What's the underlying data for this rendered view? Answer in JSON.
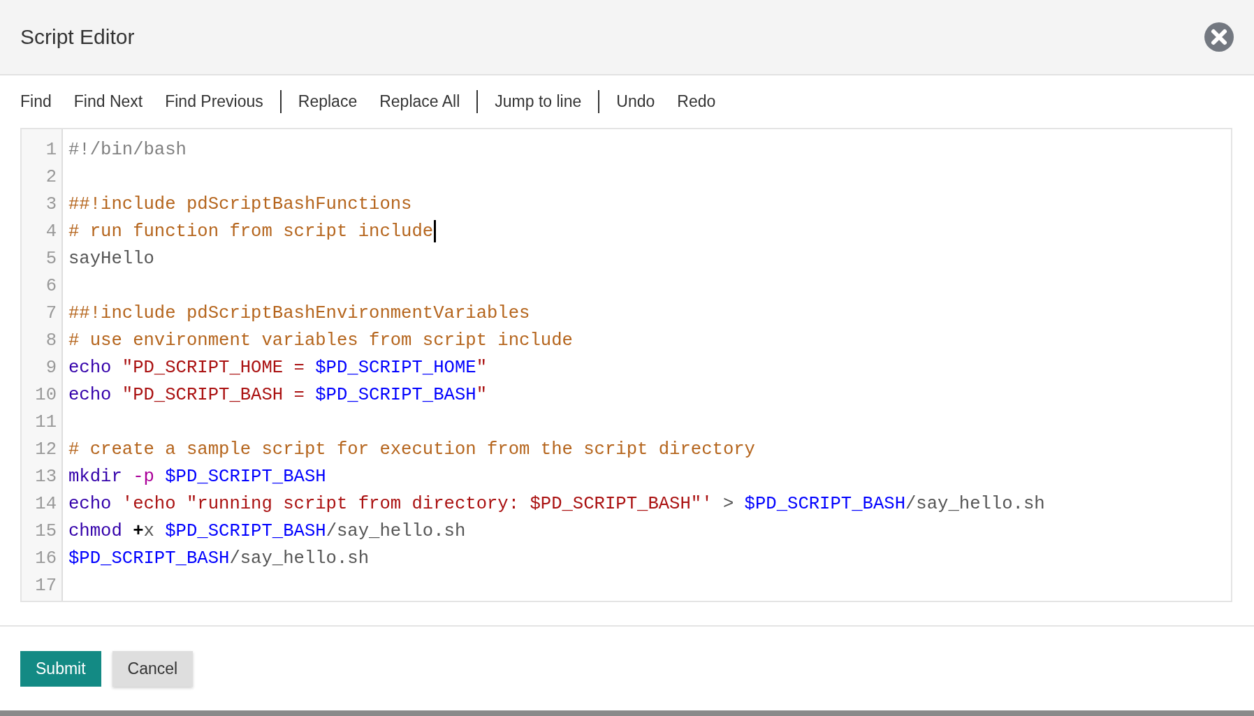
{
  "dialog": {
    "title": "Script Editor"
  },
  "toolbar": [
    [
      "Find",
      "Find Next",
      "Find Previous"
    ],
    [
      "Replace",
      "Replace All"
    ],
    [
      "Jump to line"
    ],
    [
      "Undo",
      "Redo"
    ]
  ],
  "editor": {
    "lines": [
      {
        "number": "1",
        "cursor": false,
        "tokens": [
          {
            "kind": "meta",
            "text": "#!/bin/bash"
          }
        ]
      },
      {
        "number": "2",
        "cursor": false
      },
      {
        "number": "3",
        "cursor": false,
        "tokens": [
          {
            "kind": "comment",
            "text": "##!include pdScriptBashFunctions"
          }
        ]
      },
      {
        "number": "4",
        "cursor": true,
        "tokens": [
          {
            "kind": "comment",
            "text": "# run function from script include"
          }
        ]
      },
      {
        "number": "5",
        "cursor": false,
        "tokens": [
          {
            "kind": "plain",
            "text": "sayHello"
          }
        ]
      },
      {
        "number": "6",
        "cursor": false
      },
      {
        "number": "7",
        "cursor": false,
        "tokens": [
          {
            "kind": "comment",
            "text": "##!include pdScriptBashEnvironmentVariables"
          }
        ]
      },
      {
        "number": "8",
        "cursor": false,
        "tokens": [
          {
            "kind": "comment",
            "text": "# use environment variables from script include"
          }
        ]
      },
      {
        "number": "9",
        "cursor": false,
        "tokens": [
          {
            "kind": "builtin",
            "text": "echo "
          },
          {
            "kind": "string",
            "text": "\"PD_SCRIPT_HOME = "
          },
          {
            "kind": "variable",
            "text": "$PD_SCRIPT_HOME"
          },
          {
            "kind": "string",
            "text": "\""
          }
        ]
      },
      {
        "number": "10",
        "cursor": false,
        "tokens": [
          {
            "kind": "builtin",
            "text": "echo "
          },
          {
            "kind": "string",
            "text": "\"PD_SCRIPT_BASH = "
          },
          {
            "kind": "variable",
            "text": "$PD_SCRIPT_BASH"
          },
          {
            "kind": "string",
            "text": "\""
          }
        ]
      },
      {
        "number": "11",
        "cursor": false
      },
      {
        "number": "12",
        "cursor": false,
        "tokens": [
          {
            "kind": "comment",
            "text": "# create a sample script for execution from the script directory"
          }
        ]
      },
      {
        "number": "13",
        "cursor": false,
        "tokens": [
          {
            "kind": "builtin",
            "text": "mkdir "
          },
          {
            "kind": "option",
            "text": "-p "
          },
          {
            "kind": "variable",
            "text": "$PD_SCRIPT_BASH"
          }
        ]
      },
      {
        "number": "14",
        "cursor": false,
        "tokens": [
          {
            "kind": "builtin",
            "text": "echo "
          },
          {
            "kind": "string",
            "text": "'echo \"running script from directory: $PD_SCRIPT_BASH\"'"
          },
          {
            "kind": "plain",
            "text": " > "
          },
          {
            "kind": "variable",
            "text": "$PD_SCRIPT_BASH"
          },
          {
            "kind": "plain",
            "text": "/say_hello.sh"
          }
        ]
      },
      {
        "number": "15",
        "cursor": false,
        "tokens": [
          {
            "kind": "builtin",
            "text": "chmod "
          },
          {
            "kind": "operator",
            "text": "+"
          },
          {
            "kind": "plain",
            "text": "x "
          },
          {
            "kind": "variable",
            "text": "$PD_SCRIPT_BASH"
          },
          {
            "kind": "plain",
            "text": "/say_hello.sh"
          }
        ]
      },
      {
        "number": "16",
        "cursor": false,
        "tokens": [
          {
            "kind": "variable",
            "text": "$PD_SCRIPT_BASH"
          },
          {
            "kind": "plain",
            "text": "/say_hello.sh"
          }
        ]
      },
      {
        "number": "17",
        "cursor": false
      }
    ]
  },
  "footer": {
    "buttons": [
      {
        "kind": "primary",
        "label": "Submit"
      },
      {
        "kind": "secondary",
        "label": "Cancel"
      }
    ]
  }
}
